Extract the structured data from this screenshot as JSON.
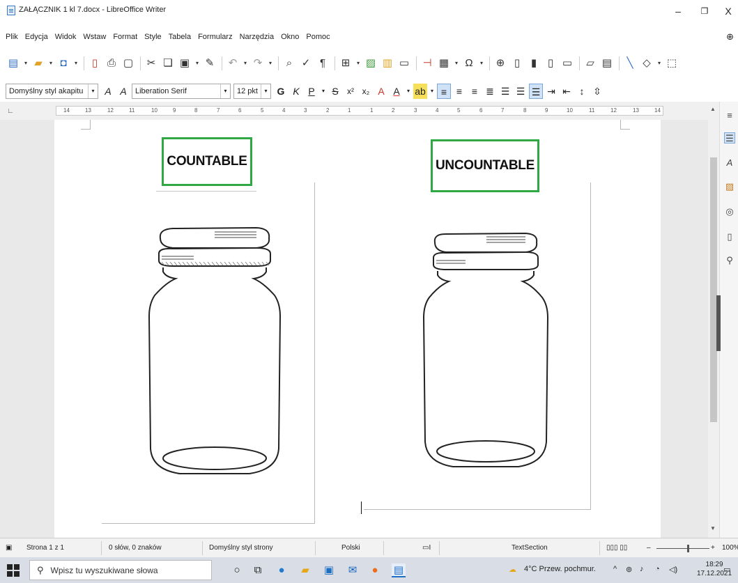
{
  "window": {
    "title": "ZAŁĄCZNIK 1 kl 7.docx - LibreOffice Writer",
    "minimize": "–",
    "restore": "❐",
    "close": "X"
  },
  "menu": [
    "Plik",
    "Edycja",
    "Widok",
    "Wstaw",
    "Format",
    "Style",
    "Tabela",
    "Formularz",
    "Narzędzia",
    "Okno",
    "Pomoc"
  ],
  "toolbar2": {
    "paragraph_style": "Domyślny styl akapitu",
    "font_name": "Liberation Serif",
    "font_size": "12 pkt",
    "bold": "G",
    "italic": "K",
    "underline": "P",
    "strike": "S",
    "superscript": "x²",
    "subscript": "x₂"
  },
  "ruler": {
    "ticks": [
      "14",
      "13",
      "12",
      "11",
      "10",
      "9",
      "8",
      "7",
      "6",
      "5",
      "4",
      "3",
      "2",
      "1",
      "1",
      "2",
      "3",
      "4",
      "5",
      "6",
      "7",
      "8",
      "9",
      "10",
      "11",
      "12",
      "13",
      "14"
    ]
  },
  "document": {
    "left_label": "COUNTABLE",
    "right_label": "UNCOUNTABLE"
  },
  "status": {
    "page": "Strona 1 z 1",
    "words": "0 słów, 0 znaków",
    "page_style": "Domyślny styl strony",
    "language": "Polski",
    "section": "TextSection",
    "zoom": "100%"
  },
  "taskbar": {
    "search_placeholder": "Wpisz tu wyszukiwane słowa",
    "weather": "4°C  Przew. pochmur.",
    "time": "18:29",
    "date": "17.12.2021"
  },
  "colors": {
    "label_border": "#2fa844",
    "accent": "#2f6fc4"
  }
}
